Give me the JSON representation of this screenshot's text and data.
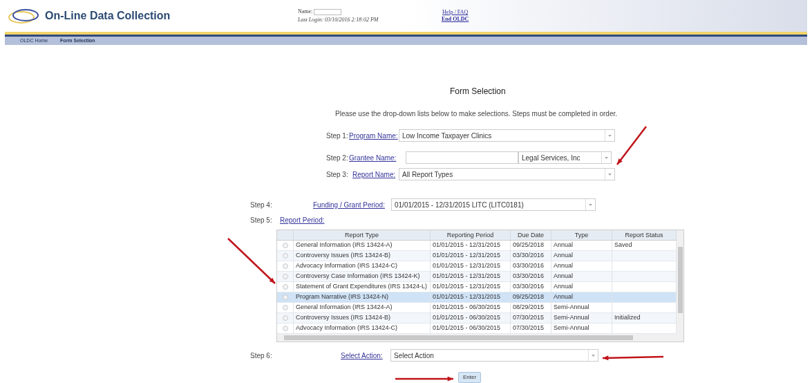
{
  "header": {
    "title": "On-Line Data Collection",
    "name_label": "Name:",
    "last_login": "Last Login: 03/10/2016 2:18:02 PM",
    "links": [
      "Help / FAQ",
      "End OLDC"
    ]
  },
  "nav": [
    {
      "label": "OLDC Home",
      "selected": false
    },
    {
      "label": "Form Selection",
      "selected": true
    }
  ],
  "form": {
    "title": "Form Selection",
    "instructions": "Please use the drop-down lists below to make selections. Steps must be completed in order.",
    "step1": {
      "step": "Step 1:",
      "link": "Program Name:",
      "value": "Low Income Taxpayer Clinics"
    },
    "step2": {
      "step": "Step 2:",
      "link": "Grantee Name:",
      "value": "Legal Services, Inc"
    },
    "step3": {
      "step": "Step 3:",
      "link": "Report Name:",
      "value": "All Report Types"
    },
    "step4": {
      "step": "Step 4:",
      "link": "Funding / Grant Period:",
      "value": "01/01/2015 - 12/31/2015 LITC (LITC0181)"
    },
    "step5": {
      "step": "Step 5:",
      "link": "Report Period:"
    },
    "step6": {
      "step": "Step 6:",
      "link": "Select Action:",
      "value": "Select Action"
    },
    "enter": "Enter"
  },
  "table": {
    "columns": [
      "Report Type",
      "Reporting Period",
      "Due Date",
      "Type",
      "Report Status"
    ],
    "rows": [
      {
        "cells": [
          "General Information (IRS 13424-A)",
          "01/01/2015 - 12/31/2015",
          "09/25/2018",
          "Annual",
          "Saved"
        ],
        "selected": false
      },
      {
        "cells": [
          "Controversy Issues (IRS 13424-B)",
          "01/01/2015 - 12/31/2015",
          "03/30/2016",
          "Annual",
          ""
        ],
        "selected": false
      },
      {
        "cells": [
          "Advocacy Information (IRS 13424-C)",
          "01/01/2015 - 12/31/2015",
          "03/30/2016",
          "Annual",
          ""
        ],
        "selected": false
      },
      {
        "cells": [
          "Controversy Case Information (IRS 13424-K)",
          "01/01/2015 - 12/31/2015",
          "03/30/2016",
          "Annual",
          ""
        ],
        "selected": false
      },
      {
        "cells": [
          "Statement of Grant Expenditures (IRS 13424-L)",
          "01/01/2015 - 12/31/2015",
          "03/30/2016",
          "Annual",
          ""
        ],
        "selected": false
      },
      {
        "cells": [
          "Program Narrative (IRS 13424-N)",
          "01/01/2015 - 12/31/2015",
          "09/25/2018",
          "Annual",
          ""
        ],
        "selected": true
      },
      {
        "cells": [
          "General Information (IRS 13424-A)",
          "01/01/2015 - 06/30/2015",
          "08/29/2015",
          "Semi-Annual",
          ""
        ],
        "selected": false
      },
      {
        "cells": [
          "Controversy Issues (IRS 13424-B)",
          "01/01/2015 - 06/30/2015",
          "07/30/2015",
          "Semi-Annual",
          "Initialized"
        ],
        "selected": false
      },
      {
        "cells": [
          "Advocacy Information (IRS 13424-C)",
          "01/01/2015 - 06/30/2015",
          "07/30/2015",
          "Semi-Annual",
          ""
        ],
        "selected": false
      }
    ]
  }
}
